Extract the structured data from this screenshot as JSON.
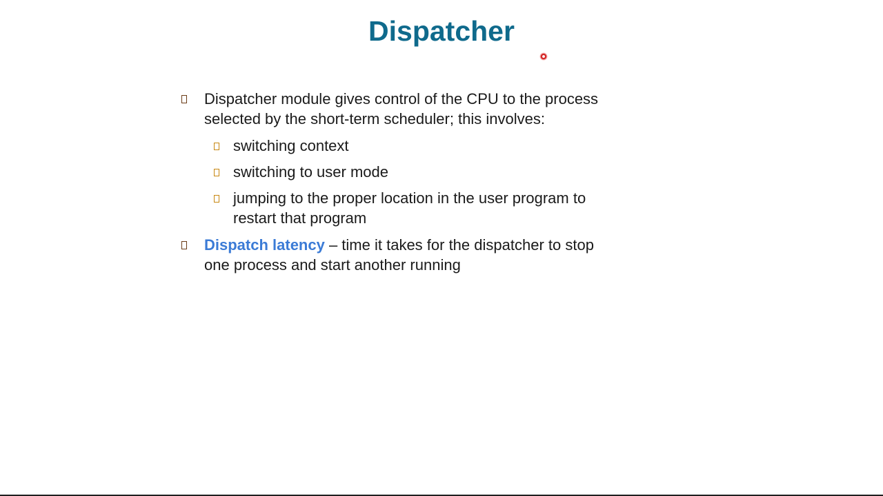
{
  "slide": {
    "title": "Dispatcher",
    "colors": {
      "title": "#0f6a8c",
      "accent": "#3b7bd6",
      "bullet_level1": "#6a3b16",
      "bullet_level2": "#c7860f",
      "pointer": "#d21e1e"
    },
    "bullets": [
      {
        "line1": "Dispatcher module gives control of the CPU to the process",
        "line2": "selected by the short-term scheduler; this involves:"
      },
      {
        "line1": "switching context"
      },
      {
        "line1": "switching to user mode"
      },
      {
        "line1": "jumping to the proper location in the user program to",
        "line2": "restart that program"
      },
      {
        "term": "Dispatch latency",
        "line1_rest": " – time it takes for the dispatcher to stop",
        "line2": "one process and start another running"
      }
    ]
  }
}
